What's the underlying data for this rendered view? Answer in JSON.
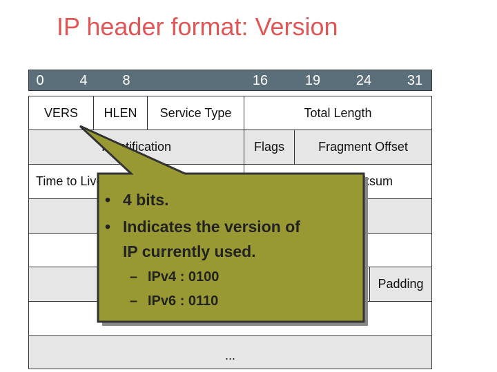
{
  "title": "IP header format: Version",
  "bits": [
    "0",
    "4",
    "8",
    "16",
    "19",
    "24",
    "31"
  ],
  "rows": {
    "r1": [
      "VERS",
      "HLEN",
      "Service Type",
      "Total Length"
    ],
    "r2": [
      "Identification",
      "Flags",
      "Fragment  Offset"
    ],
    "r3": [
      "Time to Live",
      "Header Checksum"
    ],
    "r6": [
      "Padding"
    ],
    "r8": [
      "..."
    ]
  },
  "callout": {
    "bullets": [
      "4 bits.",
      "Indicates the version of",
      "IP currently used."
    ],
    "sub": [
      "IPv4 : 0100",
      "IPv6 : 0110"
    ],
    "fill": "#999933",
    "bullet_glyph": "•",
    "dash_glyph": "–"
  }
}
